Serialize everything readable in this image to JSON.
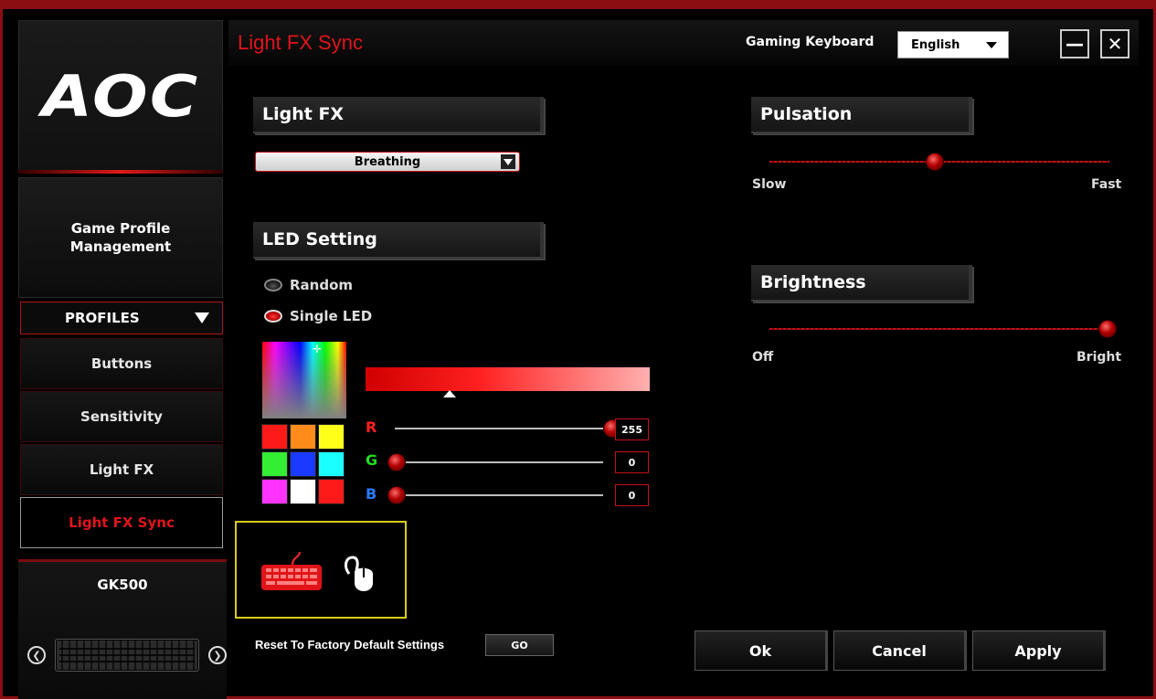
{
  "colors": {
    "accent": "#e0141c",
    "frame": "#8a0e12",
    "highlight_border": "#d8cc1a"
  },
  "logo": {
    "text": "AOC"
  },
  "sidebar": {
    "game_profile": "Game Profile Management",
    "profiles_label": "PROFILES",
    "items": [
      {
        "label": "Buttons"
      },
      {
        "label": "Sensitivity"
      },
      {
        "label": "Light FX"
      },
      {
        "label": "Light FX Sync",
        "active": true
      }
    ],
    "device": {
      "name": "GK500",
      "prev_icon": "chevron-left-circle-icon",
      "next_icon": "chevron-right-circle-icon"
    }
  },
  "header": {
    "title": "Light FX Sync",
    "device_label": "Gaming Keyboard",
    "language": "English",
    "minimize_label": "—",
    "close_label": "✕"
  },
  "light_fx": {
    "header": "Light FX",
    "selected": "Breathing"
  },
  "led_setting": {
    "header": "LED Setting",
    "random_label": "Random",
    "single_label": "Single LED",
    "selected_mode": "Single LED",
    "swatches": [
      "#ff1a1a",
      "#ff8c1a",
      "#ffff1a",
      "#33ee33",
      "#1a3aff",
      "#1affff",
      "#ff33ff",
      "#ffffff",
      "#ff1a1a"
    ],
    "rgb": {
      "r": {
        "label": "R",
        "value": "255",
        "color": "#ff2020"
      },
      "g": {
        "label": "G",
        "value": "0",
        "color": "#22dd22"
      },
      "b": {
        "label": "B",
        "value": "0",
        "color": "#2a7aff"
      }
    }
  },
  "sync_devices": {
    "keyboard_icon": "keyboard-icon",
    "mouse_icon": "mouse-icon"
  },
  "pulsation": {
    "header": "Pulsation",
    "min_label": "Slow",
    "max_label": "Fast",
    "level": 0.5
  },
  "brightness": {
    "header": "Brightness",
    "min_label": "Off",
    "max_label": "Bright",
    "level": 1.0
  },
  "footer": {
    "reset_label": "Reset To Factory Default Settings",
    "go_label": "GO",
    "ok_label": "Ok",
    "cancel_label": "Cancel",
    "apply_label": "Apply"
  }
}
